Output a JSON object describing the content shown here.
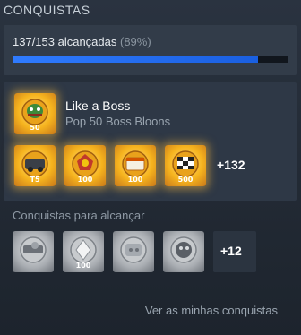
{
  "header": {
    "title": "CONQUISTAS"
  },
  "progress": {
    "summary": "137/153 alcançadas",
    "percent_text": "(89%)",
    "fraction": 0.89
  },
  "featured": {
    "title": "Like a Boss",
    "description": "Pop 50 Boss Bloons",
    "badge_label": "50"
  },
  "unlocked_badges": [
    {
      "label": "T5"
    },
    {
      "label": "100"
    },
    {
      "label": "100"
    },
    {
      "label": "500"
    }
  ],
  "unlocked_more": "+132",
  "locked": {
    "heading": "Conquistas para alcançar",
    "badges": [
      {
        "label": ""
      },
      {
        "label": "100"
      },
      {
        "label": ""
      },
      {
        "label": ""
      }
    ],
    "more": "+12"
  },
  "footer": {
    "link": "Ver as minhas conquistas"
  },
  "colors": {
    "accent": "#2f7bff",
    "gold": "#f6b41e",
    "locked": "#a9adb2"
  }
}
